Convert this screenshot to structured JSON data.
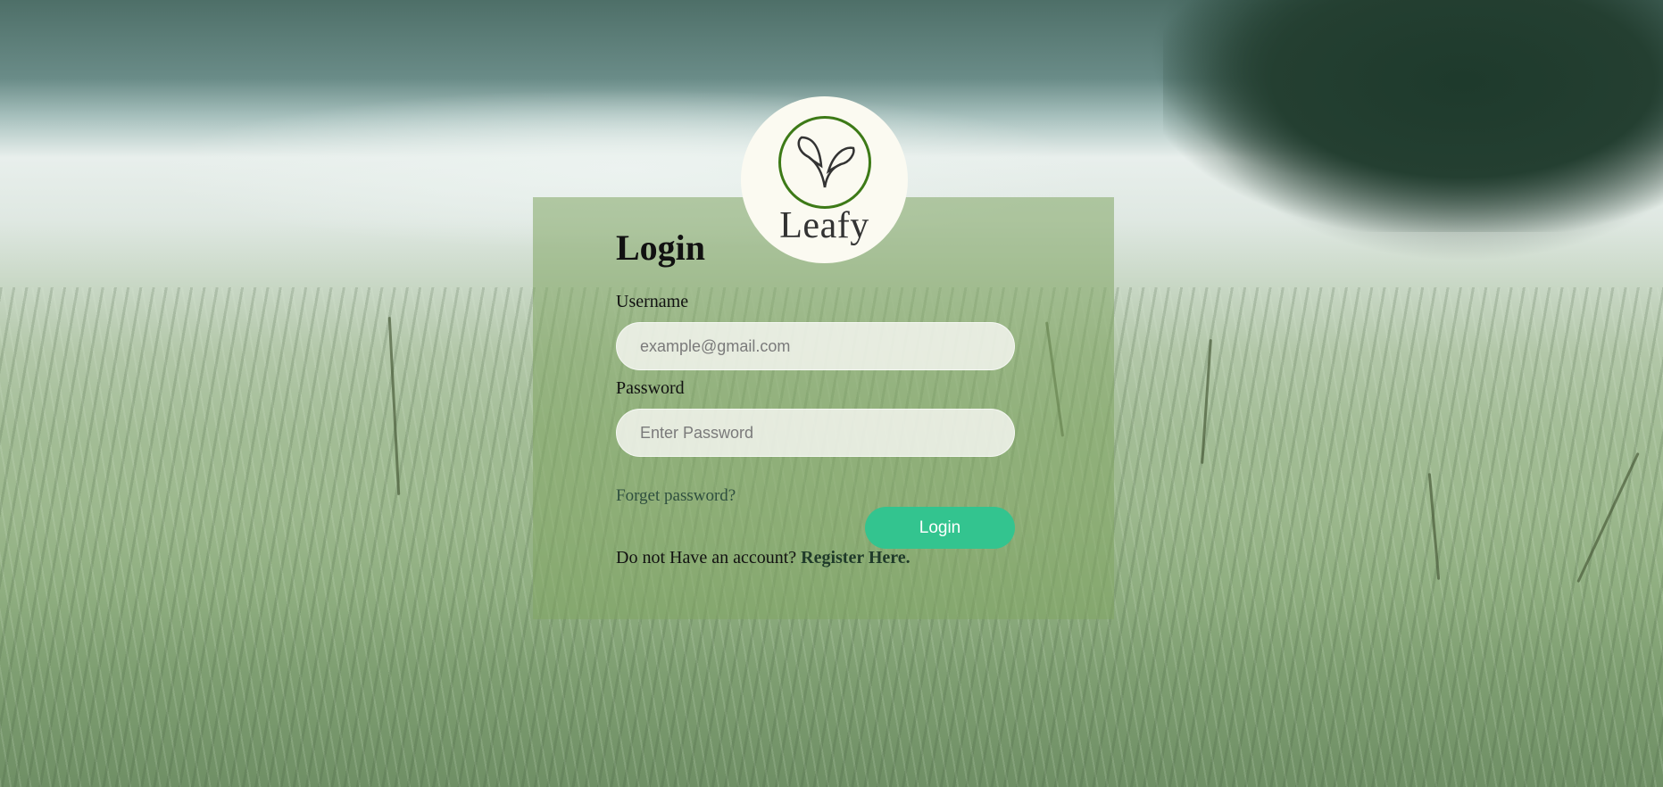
{
  "brand": {
    "name": "Leafy",
    "logo_icon": "leaf-sprout-icon",
    "accent": "#3d7a17"
  },
  "login": {
    "title": "Login",
    "username_label": "Username",
    "username_placeholder": "example@gmail.com",
    "password_label": "Password",
    "password_placeholder": "Enter Password",
    "forgot_link": "Forget password?",
    "submit_label": "Login",
    "submit_color": "#33c48f",
    "no_account_text": "Do not Have an account? ",
    "register_link": "Register Here."
  }
}
